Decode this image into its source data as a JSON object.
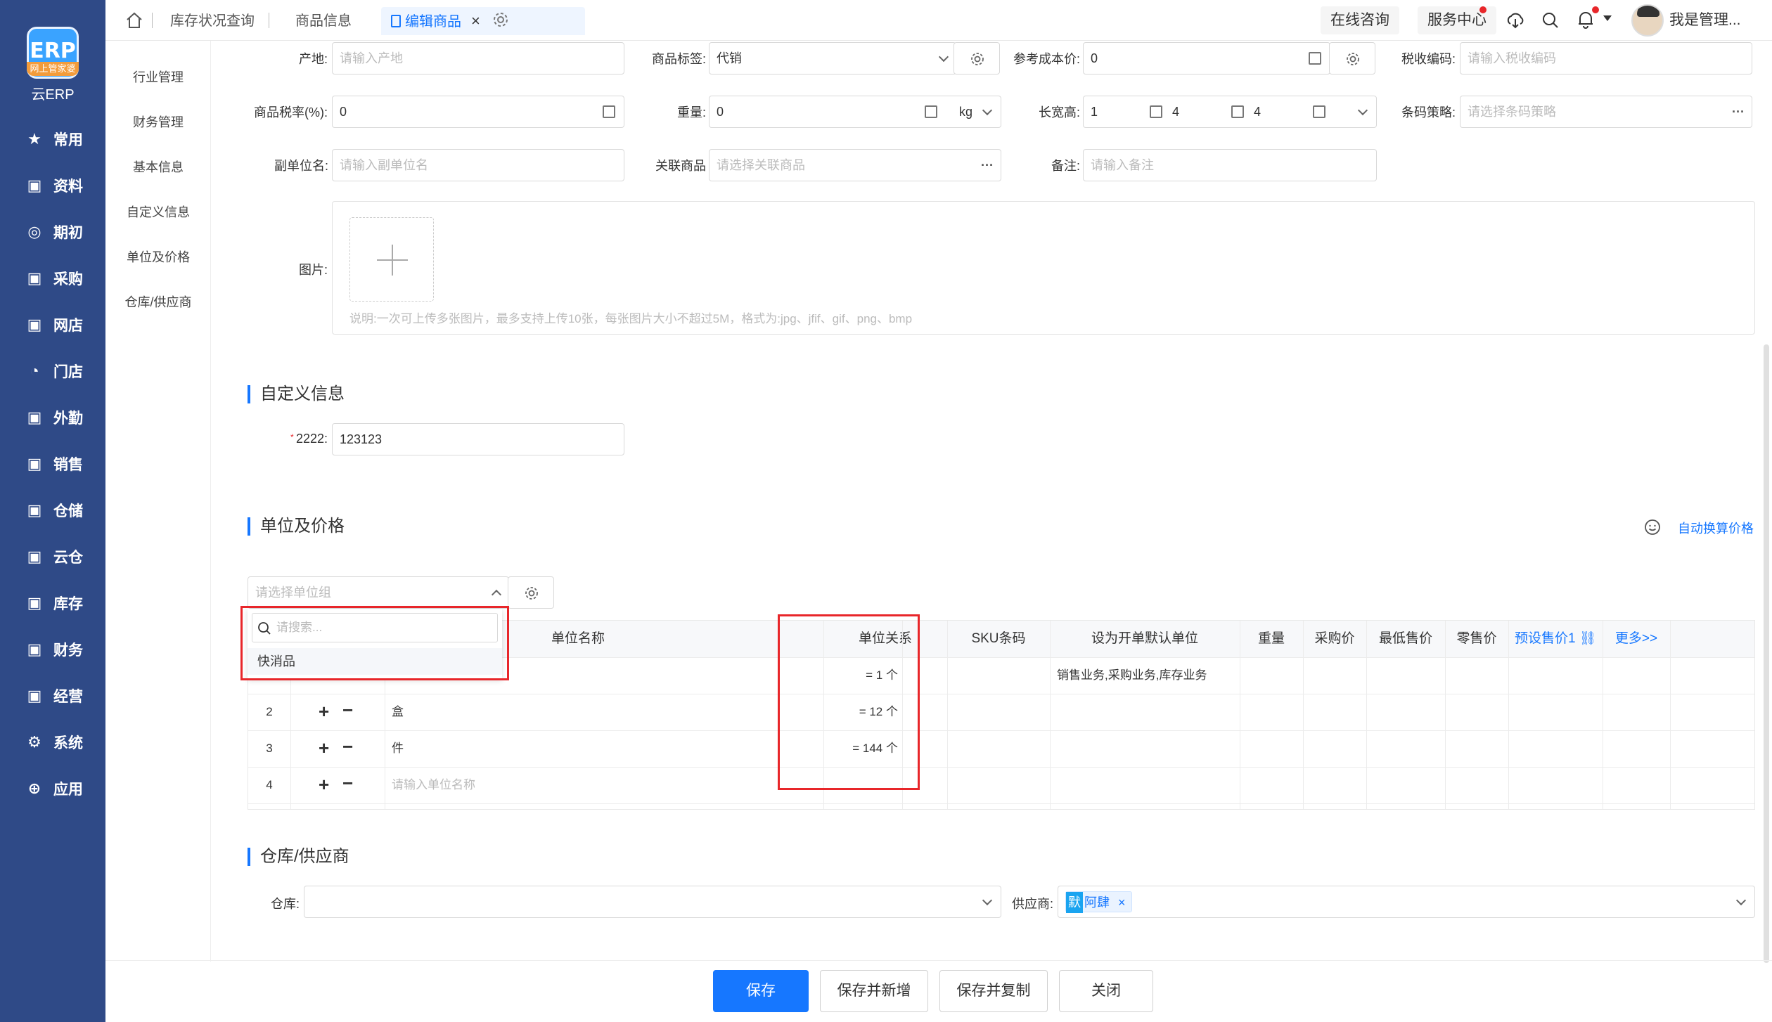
{
  "brand": {
    "logo_text": "ERP",
    "logo_band": "网上管家婆",
    "name": "云ERP"
  },
  "nav": [
    {
      "label": "常用",
      "icon": "star-icon"
    },
    {
      "label": "资料",
      "icon": "document-icon"
    },
    {
      "label": "期初",
      "icon": "target-icon"
    },
    {
      "label": "采购",
      "icon": "purchase-icon"
    },
    {
      "label": "网店",
      "icon": "store-icon"
    },
    {
      "label": "门店",
      "icon": "pie-icon"
    },
    {
      "label": "外勤",
      "icon": "field-icon"
    },
    {
      "label": "销售",
      "icon": "sales-icon"
    },
    {
      "label": "仓储",
      "icon": "warehouse-icon"
    },
    {
      "label": "云仓",
      "icon": "cloud-warehouse-icon"
    },
    {
      "label": "库存",
      "icon": "inventory-icon"
    },
    {
      "label": "财务",
      "icon": "finance-icon"
    },
    {
      "label": "经营",
      "icon": "business-icon"
    },
    {
      "label": "系统",
      "icon": "gear-icon"
    },
    {
      "label": "应用",
      "icon": "plus-icon"
    }
  ],
  "tabs": [
    {
      "label": "库存状况查询"
    },
    {
      "label": "商品信息"
    },
    {
      "label": "编辑商品"
    }
  ],
  "topbar": {
    "consult": "在线咨询",
    "service": "服务中心",
    "user": "我是管理..."
  },
  "subnav": [
    "行业管理",
    "财务管理",
    "基本信息",
    "自定义信息",
    "单位及价格",
    "仓库/供应商"
  ],
  "form": {
    "origin_label": "产地:",
    "origin_ph": "请输入产地",
    "tag_label": "商品标签:",
    "tag_value": "代销",
    "cost_label": "参考成本价:",
    "cost_value": "0",
    "tax_code_label": "税收编码:",
    "tax_code_ph": "请输入税收编码",
    "tax_rate_label": "商品税率(%):",
    "tax_rate_value": "0",
    "weight_label": "重量:",
    "weight_value": "0",
    "weight_unit": "kg",
    "dims_label": "长宽高:",
    "dim_l": "1",
    "dim_w": "4",
    "dim_h": "4",
    "barcode_label": "条码策略:",
    "barcode_ph": "请选择条码策略",
    "subunit_label": "副单位名:",
    "subunit_ph": "请输入副单位名",
    "related_label": "关联商品",
    "related_ph": "请选择关联商品",
    "remark_label": "备注:",
    "remark_ph": "请输入备注",
    "image_label": "图片:",
    "image_note": "说明:一次可上传多张图片，最多支持上传10张，每张图片大小不超过5M，格式为:jpg、jfif、gif、png、bmp"
  },
  "custom": {
    "title": "自定义信息",
    "field_label": "2222:",
    "field_value": "123123"
  },
  "units": {
    "title": "单位及价格",
    "auto_price": "自动换算价格",
    "group_ph": "请选择单位组",
    "search_ph": "请搜索...",
    "dropdown_option": "快消品",
    "headers": [
      "单位名称",
      "单位关系",
      "SKU条码",
      "设为开单默认单位",
      "重量",
      "采购价",
      "最低售价",
      "零售价",
      "预设售价1",
      "更多>>"
    ],
    "rows": [
      {
        "no": "",
        "name": "",
        "relation": "= 1 个",
        "default": "销售业务,采购业务,库存业务"
      },
      {
        "no": "2",
        "name": "盒",
        "relation": "= 12 个",
        "default": ""
      },
      {
        "no": "3",
        "name": "件",
        "relation": "= 144 个",
        "default": ""
      },
      {
        "no": "4",
        "name": "请输入单位名称",
        "relation": "",
        "default": ""
      }
    ]
  },
  "warehouse": {
    "title": "仓库/供应商",
    "wh_label": "仓库:",
    "supplier_label": "供应商:",
    "supplier_badge": "默",
    "supplier_value": "阿肆"
  },
  "buttons": {
    "save": "保存",
    "save_new": "保存并新增",
    "save_copy": "保存并复制",
    "close": "关闭"
  },
  "colors": {
    "accent": "#1677ff",
    "nav_bg": "#2f4a87",
    "highlight": "#e8262a"
  }
}
